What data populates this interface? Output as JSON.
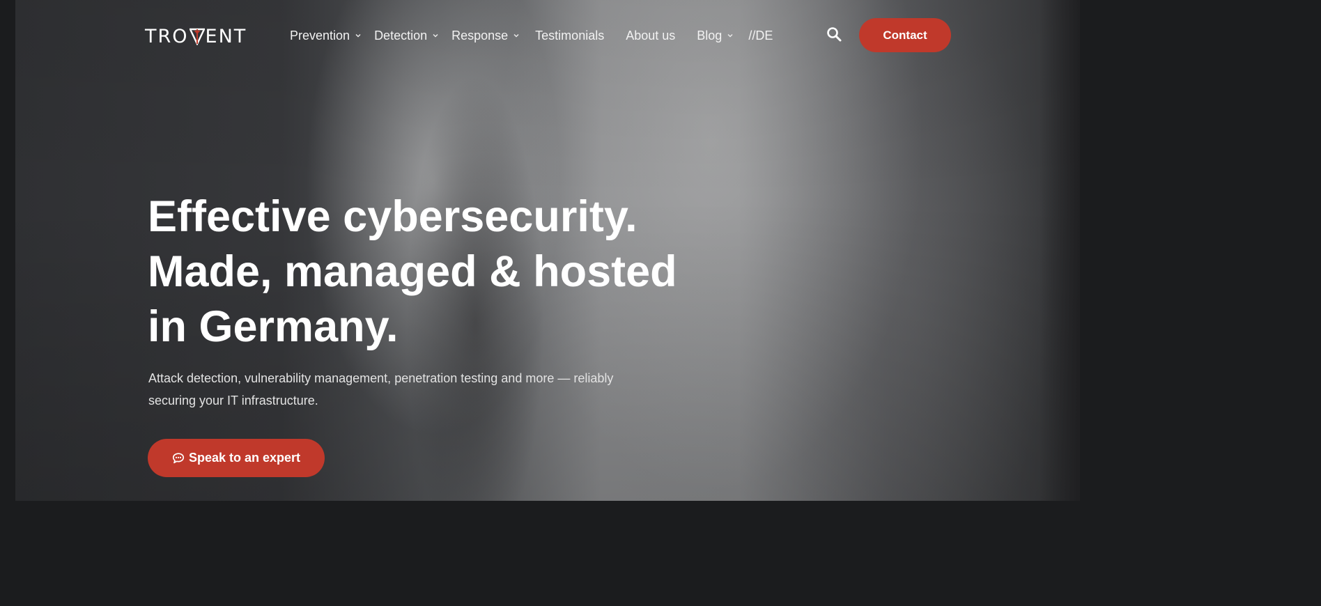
{
  "brand": {
    "logo_text_left": "TRO",
    "logo_text_right": "ENT",
    "accent_color": "#c0392b"
  },
  "nav": {
    "items": [
      {
        "label": "Prevention",
        "has_dropdown": true
      },
      {
        "label": "Detection",
        "has_dropdown": true
      },
      {
        "label": "Response",
        "has_dropdown": true
      },
      {
        "label": "Testimonials",
        "has_dropdown": false
      },
      {
        "label": "About us",
        "has_dropdown": false
      },
      {
        "label": "Blog",
        "has_dropdown": true
      },
      {
        "label": "//DE",
        "has_dropdown": false
      }
    ],
    "search_icon": "search-icon",
    "contact_label": "Contact"
  },
  "hero": {
    "headline_lines": [
      "Effective cybersecurity.",
      "Made, managed & hosted",
      "in Germany."
    ],
    "subtitle": "Attack detection, vulnerability management, penetration testing and more — reliably securing your IT infrastructure.",
    "cta_label": "Speak to an expert",
    "cta_icon": "chat-icon"
  }
}
